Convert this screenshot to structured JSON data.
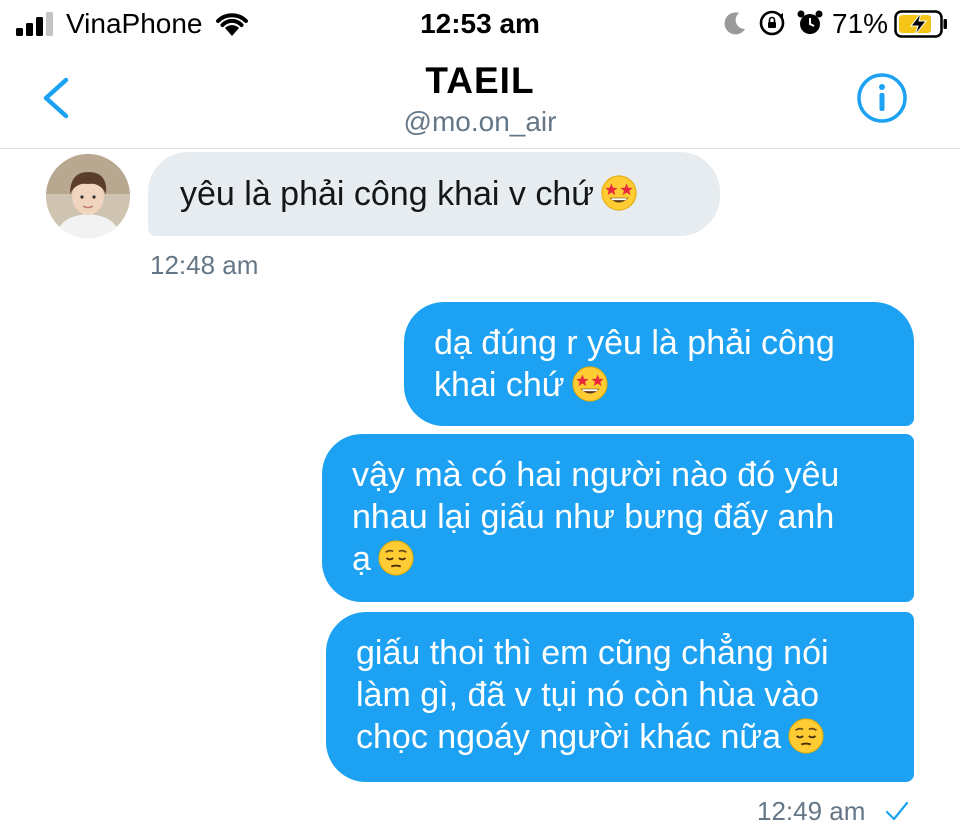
{
  "status_bar": {
    "carrier": "VinaPhone",
    "time": "12:53 am",
    "battery_percent": "71%",
    "icons": [
      "signal-icon",
      "wifi-icon",
      "moon-icon",
      "rotation-lock-icon",
      "alarm-icon",
      "battery-charging-icon"
    ]
  },
  "header": {
    "title": "TAEIL",
    "handle": "@mo.on_air",
    "back_icon": "chevron-left-icon",
    "info_icon": "info-icon",
    "accent_color": "#1da1f2"
  },
  "messages": [
    {
      "direction": "incoming",
      "text": "yêu là phải công khai v chứ",
      "emoji": "star-struck",
      "time": "12:48 am"
    },
    {
      "direction": "outgoing",
      "lines": [
        "dạ đúng r yêu là phải công",
        "khai chứ"
      ],
      "emoji": "star-struck"
    },
    {
      "direction": "outgoing",
      "lines": [
        "vậy mà có hai người nào đó yêu",
        "nhau lại giấu như bưng đấy anh",
        "ạ"
      ],
      "emoji": "pensive"
    },
    {
      "direction": "outgoing",
      "lines": [
        "giấu thoi thì em cũng chẳng nói",
        "làm gì, đã v tụi nó còn hùa vào",
        "chọc ngoáy người khác nữa"
      ],
      "emoji": "pensive",
      "time": "12:49 am",
      "status": "sent-check"
    }
  ],
  "colors": {
    "incoming_bubble": "#e6ecf0",
    "outgoing_bubble": "#1da1f2",
    "timestamp": "#657786"
  }
}
